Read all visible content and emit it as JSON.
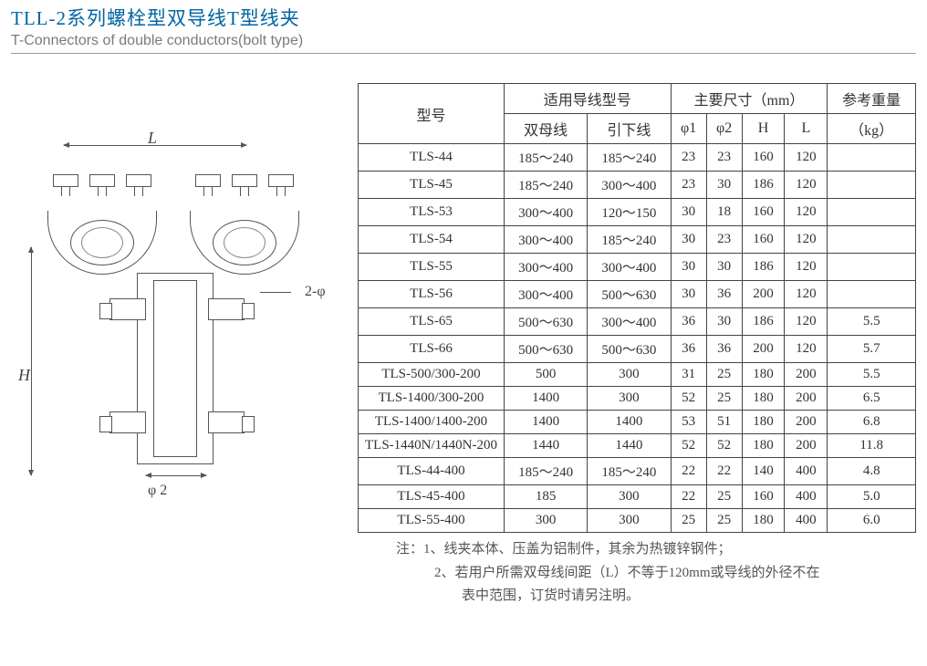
{
  "title_cn": "TLL-2系列螺栓型双导线T型线夹",
  "title_en": "T-Connectors of double conductors(bolt type)",
  "diagram": {
    "dim_L": "L",
    "dim_H": "H",
    "label_2phi": "2-φ",
    "label_phi2": "φ 2"
  },
  "headers": {
    "model": "型号",
    "applicable": "适用导线型号",
    "double_bus": "双母线",
    "lead_wire": "引下线",
    "main_dim": "主要尺寸（mm）",
    "phi1": "φ1",
    "phi2": "φ2",
    "H": "H",
    "L": "L",
    "weight": "参考重量",
    "weight_unit": "（kg）"
  },
  "chart_data": {
    "type": "table",
    "columns": [
      "型号",
      "双母线",
      "引下线",
      "φ1",
      "φ2",
      "H",
      "L",
      "参考重量(kg)"
    ],
    "rows": [
      {
        "model": "TLS-44",
        "bus": "185～240",
        "lead": "185～240",
        "phi1": "23",
        "phi2": "23",
        "H": "160",
        "L": "120",
        "kg": ""
      },
      {
        "model": "TLS-45",
        "bus": "185～240",
        "lead": "300～400",
        "phi1": "23",
        "phi2": "30",
        "H": "186",
        "L": "120",
        "kg": ""
      },
      {
        "model": "TLS-53",
        "bus": "300～400",
        "lead": "120～150",
        "phi1": "30",
        "phi2": "18",
        "H": "160",
        "L": "120",
        "kg": ""
      },
      {
        "model": "TLS-54",
        "bus": "300～400",
        "lead": "185～240",
        "phi1": "30",
        "phi2": "23",
        "H": "160",
        "L": "120",
        "kg": ""
      },
      {
        "model": "TLS-55",
        "bus": "300～400",
        "lead": "300～400",
        "phi1": "30",
        "phi2": "30",
        "H": "186",
        "L": "120",
        "kg": ""
      },
      {
        "model": "TLS-56",
        "bus": "300～400",
        "lead": "500～630",
        "phi1": "30",
        "phi2": "36",
        "H": "200",
        "L": "120",
        "kg": ""
      },
      {
        "model": "TLS-65",
        "bus": "500～630",
        "lead": "300～400",
        "phi1": "36",
        "phi2": "30",
        "H": "186",
        "L": "120",
        "kg": "5.5"
      },
      {
        "model": "TLS-66",
        "bus": "500～630",
        "lead": "500～630",
        "phi1": "36",
        "phi2": "36",
        "H": "200",
        "L": "120",
        "kg": "5.7"
      },
      {
        "model": "TLS-500/300-200",
        "bus": "500",
        "lead": "300",
        "phi1": "31",
        "phi2": "25",
        "H": "180",
        "L": "200",
        "kg": "5.5"
      },
      {
        "model": "TLS-1400/300-200",
        "bus": "1400",
        "lead": "300",
        "phi1": "52",
        "phi2": "25",
        "H": "180",
        "L": "200",
        "kg": "6.5"
      },
      {
        "model": "TLS-1400/1400-200",
        "bus": "1400",
        "lead": "1400",
        "phi1": "53",
        "phi2": "51",
        "H": "180",
        "L": "200",
        "kg": "6.8"
      },
      {
        "model": "TLS-1440N/1440N-200",
        "bus": "1440",
        "lead": "1440",
        "phi1": "52",
        "phi2": "52",
        "H": "180",
        "L": "200",
        "kg": "11.8"
      },
      {
        "model": "TLS-44-400",
        "bus": "185～240",
        "lead": "185～240",
        "phi1": "22",
        "phi2": "22",
        "H": "140",
        "L": "400",
        "kg": "4.8"
      },
      {
        "model": "TLS-45-400",
        "bus": "185",
        "lead": "300",
        "phi1": "22",
        "phi2": "25",
        "H": "160",
        "L": "400",
        "kg": "5.0"
      },
      {
        "model": "TLS-55-400",
        "bus": "300",
        "lead": "300",
        "phi1": "25",
        "phi2": "25",
        "H": "180",
        "L": "400",
        "kg": "6.0"
      }
    ]
  },
  "notes": {
    "prefix": "注：",
    "n1": "1、线夹本体、压盖为铝制件，其余为热镀锌钢件；",
    "n2a": "2、若用户所需双母线间距（L）不等于120mm或导线的外径不在",
    "n2b": "　　表中范围，订货时请另注明。"
  }
}
